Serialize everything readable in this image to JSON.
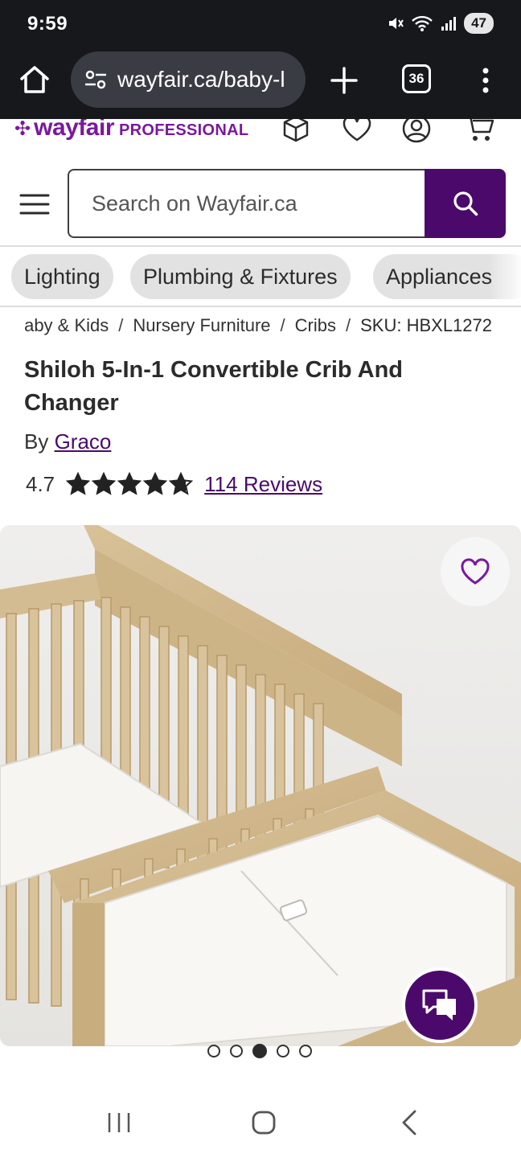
{
  "status_bar": {
    "time": "9:59",
    "battery": "47",
    "icons": [
      "mute-icon",
      "wifi-icon",
      "signal-icon"
    ]
  },
  "browser": {
    "url": "wayfair.ca/baby-l",
    "tab_count": "36"
  },
  "site_header": {
    "logo_wordmark": "wayfair",
    "logo_suffix": "PROFESSIONAL",
    "brand_color": "#7b189f",
    "icons": [
      "box-icon",
      "heart-icon",
      "account-icon",
      "cart-icon"
    ]
  },
  "search": {
    "placeholder": "Search on Wayfair.ca",
    "button_color": "#4b0a6b"
  },
  "categories": [
    "Lighting",
    "Plumbing & Fixtures",
    "Appliances"
  ],
  "breadcrumb": {
    "items": [
      "aby & Kids",
      "Nursery Furniture",
      "Cribs"
    ],
    "sku": "SKU: HBXL1272"
  },
  "product": {
    "title": "Shiloh 5-In-1 Convertible Crib And Changer",
    "by_label": "By",
    "brand": "Graco",
    "rating": "4.7",
    "rating_value": 4.7,
    "rating_max": 5,
    "reviews_label": "114 Reviews"
  },
  "carousel": {
    "count": 5,
    "active_index": 2
  }
}
